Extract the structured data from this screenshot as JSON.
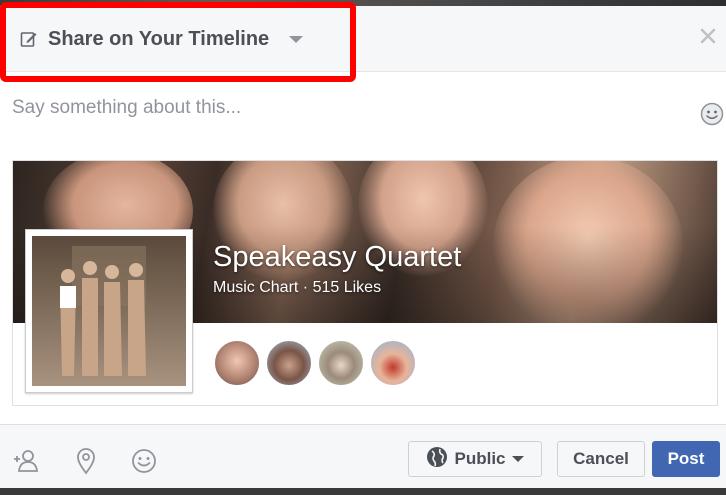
{
  "header": {
    "share_target_label": "Share on Your Timeline",
    "icons": {
      "edit": "edit-pencil-icon",
      "caret": "caret-down-icon",
      "close": "close-icon"
    }
  },
  "composer": {
    "placeholder": "Say something about this...",
    "value": "",
    "emoji_icon": "emoji-smile-icon"
  },
  "shared_page": {
    "name": "Speakeasy Quartet",
    "meta": "Music Chart · 515 Likes",
    "friend_avatars": 4
  },
  "footer": {
    "tools": [
      "tag-friend-icon",
      "location-pin-icon",
      "feeling-smile-icon"
    ],
    "audience_label": "Public",
    "audience_icon": "globe-icon",
    "cancel_label": "Cancel",
    "post_label": "Post"
  },
  "colors": {
    "accent": "#4267b2",
    "highlight": "#ff0000",
    "header_bg": "#f6f7f9",
    "text_muted": "#90949c"
  }
}
